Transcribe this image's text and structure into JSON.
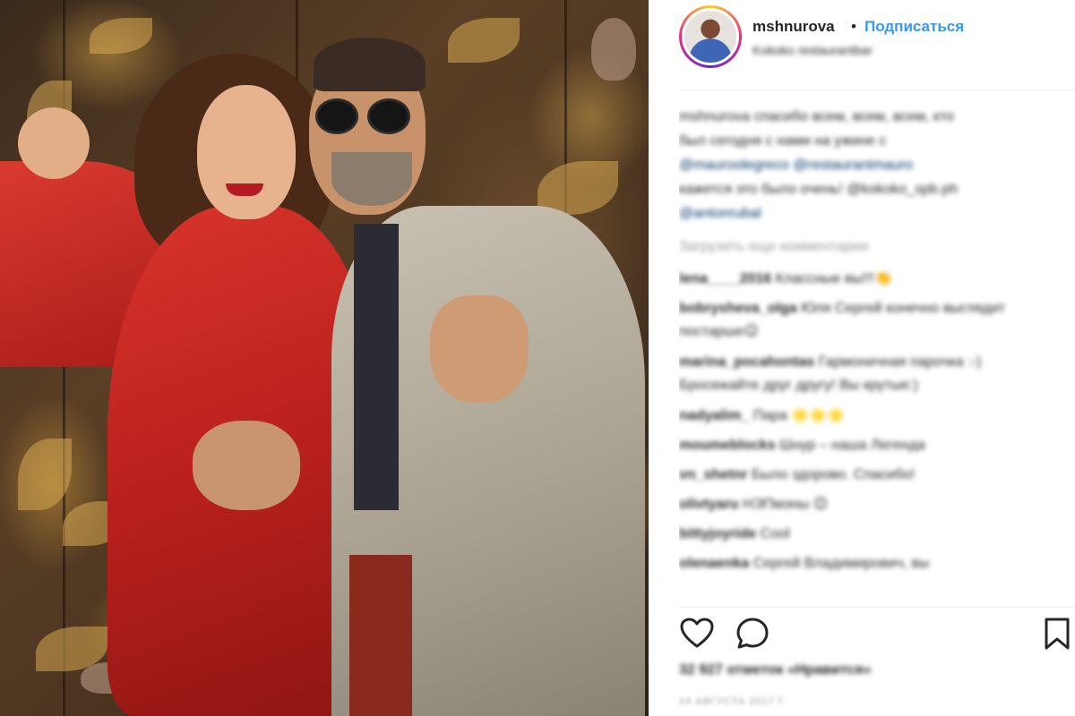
{
  "post": {
    "photo_alt": "Photo of a woman in a red dress and a man in sunglasses and a grey coat",
    "header": {
      "username": "mshnurova",
      "separator": "•",
      "follow_label": "Подписаться",
      "location": "Kokoko restaurantbar"
    },
    "caption": {
      "lines": [
        "mshnurova спасибо всем, всем, всем, кто",
        "был сегодня с нами на ужине с",
        "@mauroolegreco @restaurantmauro",
        "кажется это было очень! @kokoko_spb.ph",
        "@antonrubal"
      ]
    },
    "load_more_label": "Загрузить еще комментарии",
    "comments": [
      {
        "user": "lena____2016",
        "text": "Классные вы!!!👏"
      },
      {
        "user": "bobrysheva_olga",
        "text": "Юля Сергей конечно выглядит постарше😉"
      },
      {
        "user": "marina_pocahontas",
        "text": "Гармоничная парочка :-) Бросюкайте друг другу! Вы крутые:)"
      },
      {
        "user": "nadyalim_",
        "text": "Пара 🌟🌟🌟"
      },
      {
        "user": "moumeblocks",
        "text": "Шнур – наша Легенда"
      },
      {
        "user": "vn_shetnr",
        "text": "Было здорово. Спасибо!"
      },
      {
        "user": "olivtyaru",
        "text": "НЭПмэны 😊"
      },
      {
        "user": "bittyjoyride",
        "text": "Cool"
      },
      {
        "user": "olenaenka",
        "text": "Сергей Владимирович, вы"
      }
    ],
    "actions": {
      "like_icon": "heart-icon",
      "comment_icon": "speech-bubble-icon",
      "save_icon": "bookmark-icon"
    },
    "likes_text": "32 927 отметок «Нравится»",
    "date_text": "24 АВГУСТА 2017 Г."
  },
  "colors": {
    "link": "#3897f0",
    "mention": "#003569",
    "text": "#262626",
    "muted": "#999999"
  }
}
